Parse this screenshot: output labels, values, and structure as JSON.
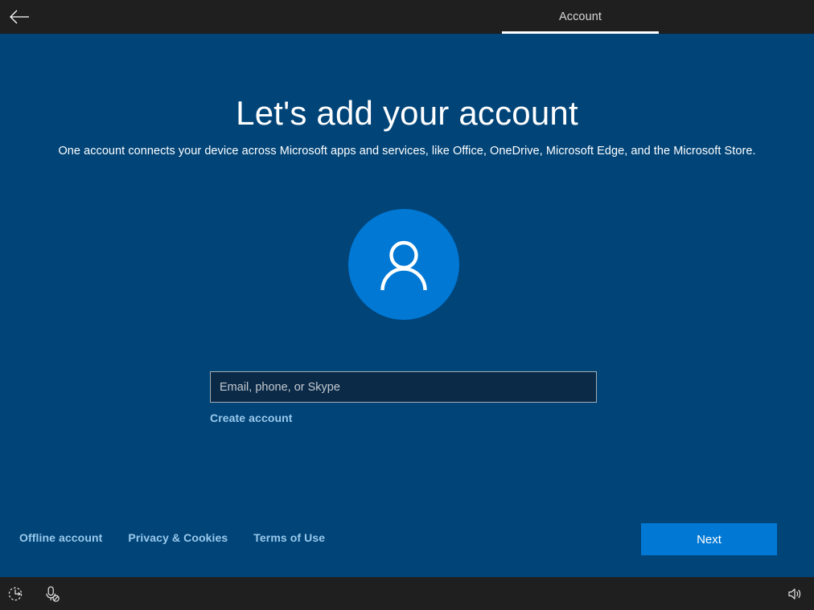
{
  "header": {
    "back_icon": "arrow-left-icon",
    "tab_label": "Account"
  },
  "main": {
    "title": "Let's add your account",
    "subtitle": "One account connects your device across Microsoft apps and services, like Office, OneDrive, Microsoft Edge, and the Microsoft Store.",
    "avatar_icon": "person-icon",
    "account_input": {
      "placeholder": "Email, phone, or Skype",
      "value": ""
    },
    "create_account_label": "Create account"
  },
  "footer": {
    "links": [
      {
        "label": "Offline account"
      },
      {
        "label": "Privacy & Cookies"
      },
      {
        "label": "Terms of Use"
      }
    ],
    "next_label": "Next"
  },
  "taskbar": {
    "ease_of_access_icon": "ease-of-access-icon",
    "microphone_off_icon": "microphone-off-icon",
    "volume_icon": "volume-icon"
  },
  "colors": {
    "background_blue": "#004478",
    "accent_blue": "#0078d4",
    "chrome_dark": "#1f1f1f",
    "link_blue": "#9ac9ec",
    "input_fill": "#0a2a48"
  }
}
